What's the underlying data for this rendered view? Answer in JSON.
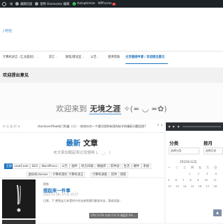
{
  "adminbar": {
    "items": [
      "站",
      "编辑页面",
      "使用 Elementor 编辑",
      "Autoptimize",
      "WPForms"
    ],
    "wpforms_badge": "1",
    "colors": {
      "bg": "#1d2327",
      "autoptimize_dot": "#3dbb5a",
      "wpforms_badge": "#d63638"
    }
  },
  "site": {
    "title": "/ 时光"
  },
  "nav": {
    "items": [
      {
        "label": "计算机语言（汇总类别）",
        "has_dropdown": true
      },
      {
        "label": "其它",
        "has_dropdown": true
      },
      {
        "label": "随笔/建议区",
        "has_dropdown": true
      },
      {
        "label": "公告",
        "has_dropdown": true
      },
      {
        "label": "使用帮助",
        "has_dropdown": false
      },
      {
        "label": "主页链接申请 / 欢迎提出意见",
        "has_dropdown": false,
        "active": true
      }
    ],
    "accent": "#1e73be"
  },
  "page": {
    "title": "欢迎提出意见"
  },
  "hero": {
    "prefix": "欢迎来到",
    "highlight": "无境之涯",
    "suffix": "✧(≖ ◡ ≖✿)"
  },
  "ticker": {
    "label": "≡ 公 告 栏 ≡",
    "text": "stackoverflow均门利器（二）- 如何针对一个提问找到有用的帖子的精彩问题回答?",
    "nav": "⇧ ↓"
  },
  "latest": {
    "blue": "最新",
    "black": "文章",
    "subtitle": "老文章加载起来比较慢噢 (。._。 )"
  },
  "tags": {
    "row1": [
      "全部",
      "LeetCode",
      "SEO",
      "WordPress",
      "公告",
      "插件",
      "经方同辅",
      "数据库",
      "软件园",
      "生活",
      "硬件",
      "系统"
    ],
    "row2": [
      "虚拟机/docker",
      "计算机理论",
      "计算机语言",
      "计算机调查",
      "软件",
      "随笔"
    ],
    "active": "全部"
  },
  "post": {
    "category": "随笔",
    "title": "想起来一件事",
    "date": "2022-12-18  /  2个月 15:27",
    "excerpt": "日常，下 想到这几年是时兴辛苦来到我们都很辛苦，我欢欣鼓..."
  },
  "sidebar": {
    "heading_categories": "分类",
    "heading_archive": "按月",
    "category_select": "选择分类",
    "archive_select": "选择月份",
    "calendar_caption": "2022年12月",
    "calendar_rows": [
      [
        "一",
        "二",
        "三",
        "四",
        "五",
        "六",
        "日"
      ],
      [
        "",
        "",
        "",
        "1",
        "2",
        "3",
        "4"
      ],
      [
        "5",
        "6",
        "7",
        "8",
        "9",
        "10",
        "11"
      ],
      [
        "12",
        "13",
        "14",
        "15",
        "16",
        "17",
        "18"
      ]
    ]
  },
  "stats": {
    "text": "CPU 0.0%  内存 0.0 %  磁盘0.0% ..."
  }
}
